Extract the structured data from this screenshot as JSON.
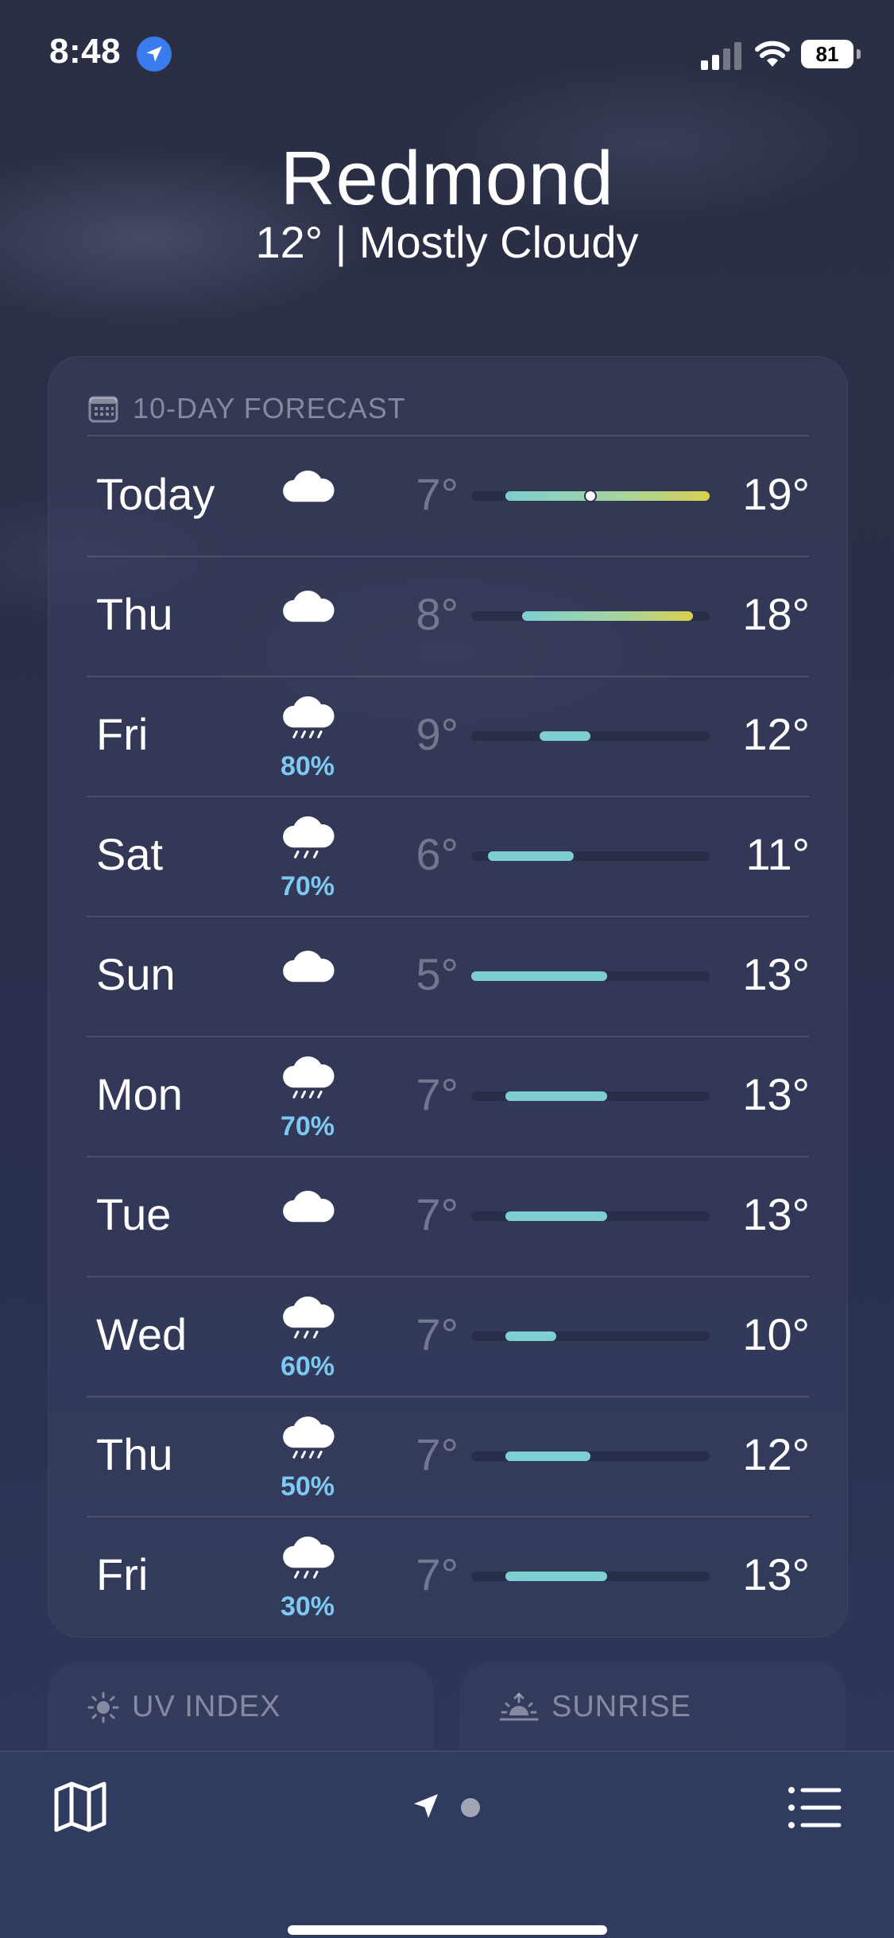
{
  "status_bar": {
    "time": "8:48",
    "battery": "81"
  },
  "header": {
    "city": "Redmond",
    "summary": "12° | Mostly Cloudy"
  },
  "forecast": {
    "title": "10-DAY FORECAST",
    "range_min": 5,
    "range_max": 19,
    "current_temp": 12,
    "days": [
      {
        "day": "Today",
        "icon": "cloud-icon",
        "precip": "",
        "lo": "7°",
        "hi": "19°",
        "lo_val": 7,
        "hi_val": 19
      },
      {
        "day": "Thu",
        "icon": "cloud-icon",
        "precip": "",
        "lo": "8°",
        "hi": "18°",
        "lo_val": 8,
        "hi_val": 18
      },
      {
        "day": "Fri",
        "icon": "cloud-rain-icon",
        "precip": "80%",
        "lo": "9°",
        "hi": "12°",
        "lo_val": 9,
        "hi_val": 12
      },
      {
        "day": "Sat",
        "icon": "cloud-drizzle-icon",
        "precip": "70%",
        "lo": "6°",
        "hi": "11°",
        "lo_val": 6,
        "hi_val": 11
      },
      {
        "day": "Sun",
        "icon": "cloud-icon",
        "precip": "",
        "lo": "5°",
        "hi": "13°",
        "lo_val": 5,
        "hi_val": 13
      },
      {
        "day": "Mon",
        "icon": "cloud-rain-icon",
        "precip": "70%",
        "lo": "7°",
        "hi": "13°",
        "lo_val": 7,
        "hi_val": 13
      },
      {
        "day": "Tue",
        "icon": "cloud-icon",
        "precip": "",
        "lo": "7°",
        "hi": "13°",
        "lo_val": 7,
        "hi_val": 13
      },
      {
        "day": "Wed",
        "icon": "cloud-drizzle-icon",
        "precip": "60%",
        "lo": "7°",
        "hi": "10°",
        "lo_val": 7,
        "hi_val": 10
      },
      {
        "day": "Thu",
        "icon": "cloud-rain-icon",
        "precip": "50%",
        "lo": "7°",
        "hi": "12°",
        "lo_val": 7,
        "hi_val": 12
      },
      {
        "day": "Fri",
        "icon": "cloud-drizzle-icon",
        "precip": "30%",
        "lo": "7°",
        "hi": "13°",
        "lo_val": 7,
        "hi_val": 13
      }
    ]
  },
  "tiles": {
    "uv_label": "UV INDEX",
    "sunrise_label": "SUNRISE"
  },
  "colors": {
    "cool": "#7ecfd1",
    "warm": "#d9cf4f",
    "precip": "#7ec9f2"
  }
}
